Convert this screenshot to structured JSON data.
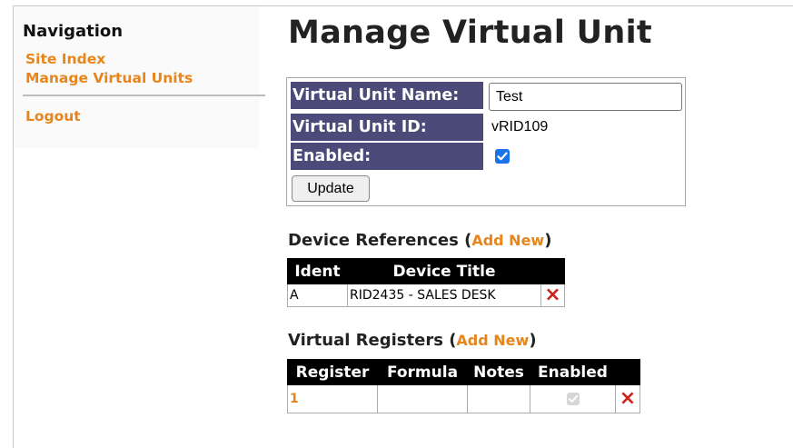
{
  "nav": {
    "heading": "Navigation",
    "items": [
      {
        "label": "Site Index"
      },
      {
        "label": "Manage Virtual Units"
      },
      {
        "label": "Logout"
      }
    ]
  },
  "page": {
    "title": "Manage Virtual Unit"
  },
  "form": {
    "name_label": "Virtual Unit Name:",
    "name_value": "Test",
    "id_label": "Virtual Unit ID:",
    "id_value": "vRID109",
    "enabled_label": "Enabled:",
    "enabled": true,
    "update_label": "Update"
  },
  "devices": {
    "heading": "Device References",
    "open_paren": "(",
    "add_label": "Add New",
    "close_paren": ")",
    "columns": [
      "Ident",
      "Device Title",
      ""
    ],
    "rows": [
      {
        "ident": "A",
        "title": "RID2435 - SALES DESK",
        "delete_icon": "×"
      }
    ]
  },
  "registers": {
    "heading": "Virtual Registers",
    "open_paren": "(",
    "add_label": "Add New",
    "close_paren": ")",
    "columns": [
      "Register",
      "Formula",
      "Notes",
      "Enabled",
      ""
    ],
    "rows": [
      {
        "register": "1",
        "formula": "",
        "notes": "",
        "enabled": true,
        "enabled_disabled_control": true,
        "delete_icon": "×"
      }
    ]
  },
  "colors": {
    "accent": "#e8851a",
    "label_bg": "#4b4a78",
    "header_bg": "#000000",
    "delete": "#d0201c",
    "checkbox": "#1a73e8"
  },
  "icons": {
    "check": "checkmark-icon",
    "delete": "delete-x-icon"
  }
}
